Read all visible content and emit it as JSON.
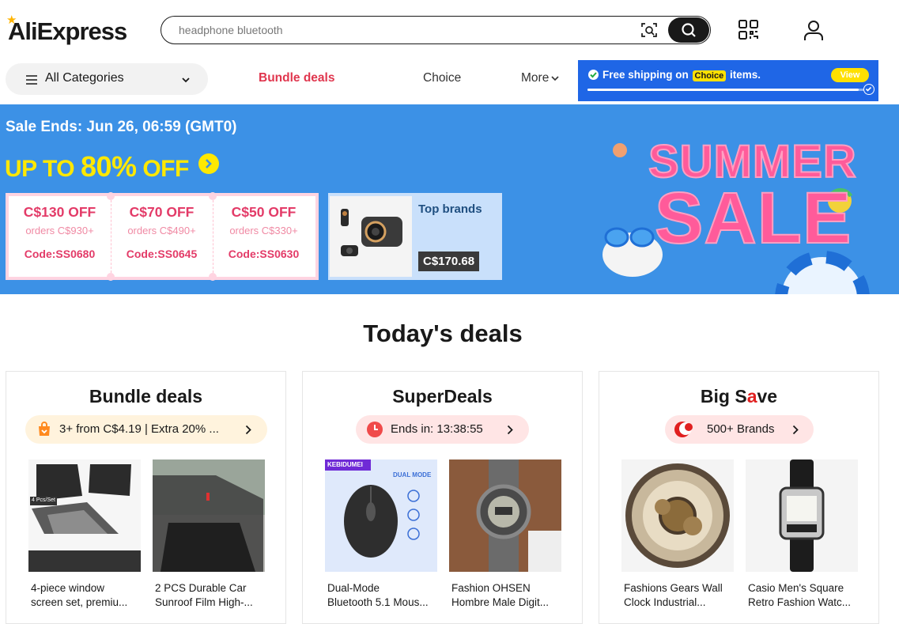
{
  "header": {
    "logo": "AliExpress",
    "search_placeholder": "headphone bluetooth"
  },
  "nav": {
    "categories": "All Categories",
    "bundle": "Bundle deals",
    "choice": "Choice",
    "more": "More"
  },
  "shipping": {
    "text_before": "Free shipping on",
    "choice_badge": "Choice",
    "text_after": "items.",
    "view": "View",
    "progress": 0.97
  },
  "banner": {
    "sale_ends": "Sale Ends: Jun 26, 06:59 (GMT0)",
    "upto_prefix": "UP TO",
    "upto_big": "80%",
    "upto_suffix": "OFF",
    "coupons": [
      {
        "off": "C$130 OFF",
        "orders": "orders C$930+",
        "code": "Code:SS0680"
      },
      {
        "off": "C$70 OFF",
        "orders": "orders C$490+",
        "code": "Code:SS0645"
      },
      {
        "off": "C$50 OFF",
        "orders": "orders C$330+",
        "code": "Code:SS0630"
      }
    ],
    "top_brands": "Top brands",
    "brand_price": "C$170.68",
    "summer_line1": "SUMMER",
    "summer_line2": "SALE"
  },
  "deals": {
    "title": "Today's deals",
    "cards": [
      {
        "title": "Bundle deals",
        "pill": "3+ from C$4.19 | Extra 20% ...",
        "products": [
          {
            "name1": "4-piece window",
            "name2": "screen set, premiu...",
            "badge": "4 Pcs/Set"
          },
          {
            "name1": "2 PCS Durable Car",
            "name2": "Sunroof Film High-..."
          }
        ]
      },
      {
        "title": "SuperDeals",
        "pill": "Ends in: 13:38:55",
        "products": [
          {
            "name1": "Dual-Mode",
            "name2": "Bluetooth 5.1 Mous...",
            "brand": "KEBIDUMEI",
            "mode": "DUAL MODE"
          },
          {
            "name1": "Fashion OHSEN",
            "name2": "Hombre Male Digit..."
          }
        ]
      },
      {
        "title_a": "Big S",
        "title_b": "a",
        "title_c": "ve",
        "pill": "500+ Brands",
        "products": [
          {
            "name1": "Fashions Gears Wall",
            "name2": "Clock Industrial..."
          },
          {
            "name1": "Casio Men's Square",
            "name2": "Retro Fashion Watc..."
          }
        ]
      }
    ]
  }
}
